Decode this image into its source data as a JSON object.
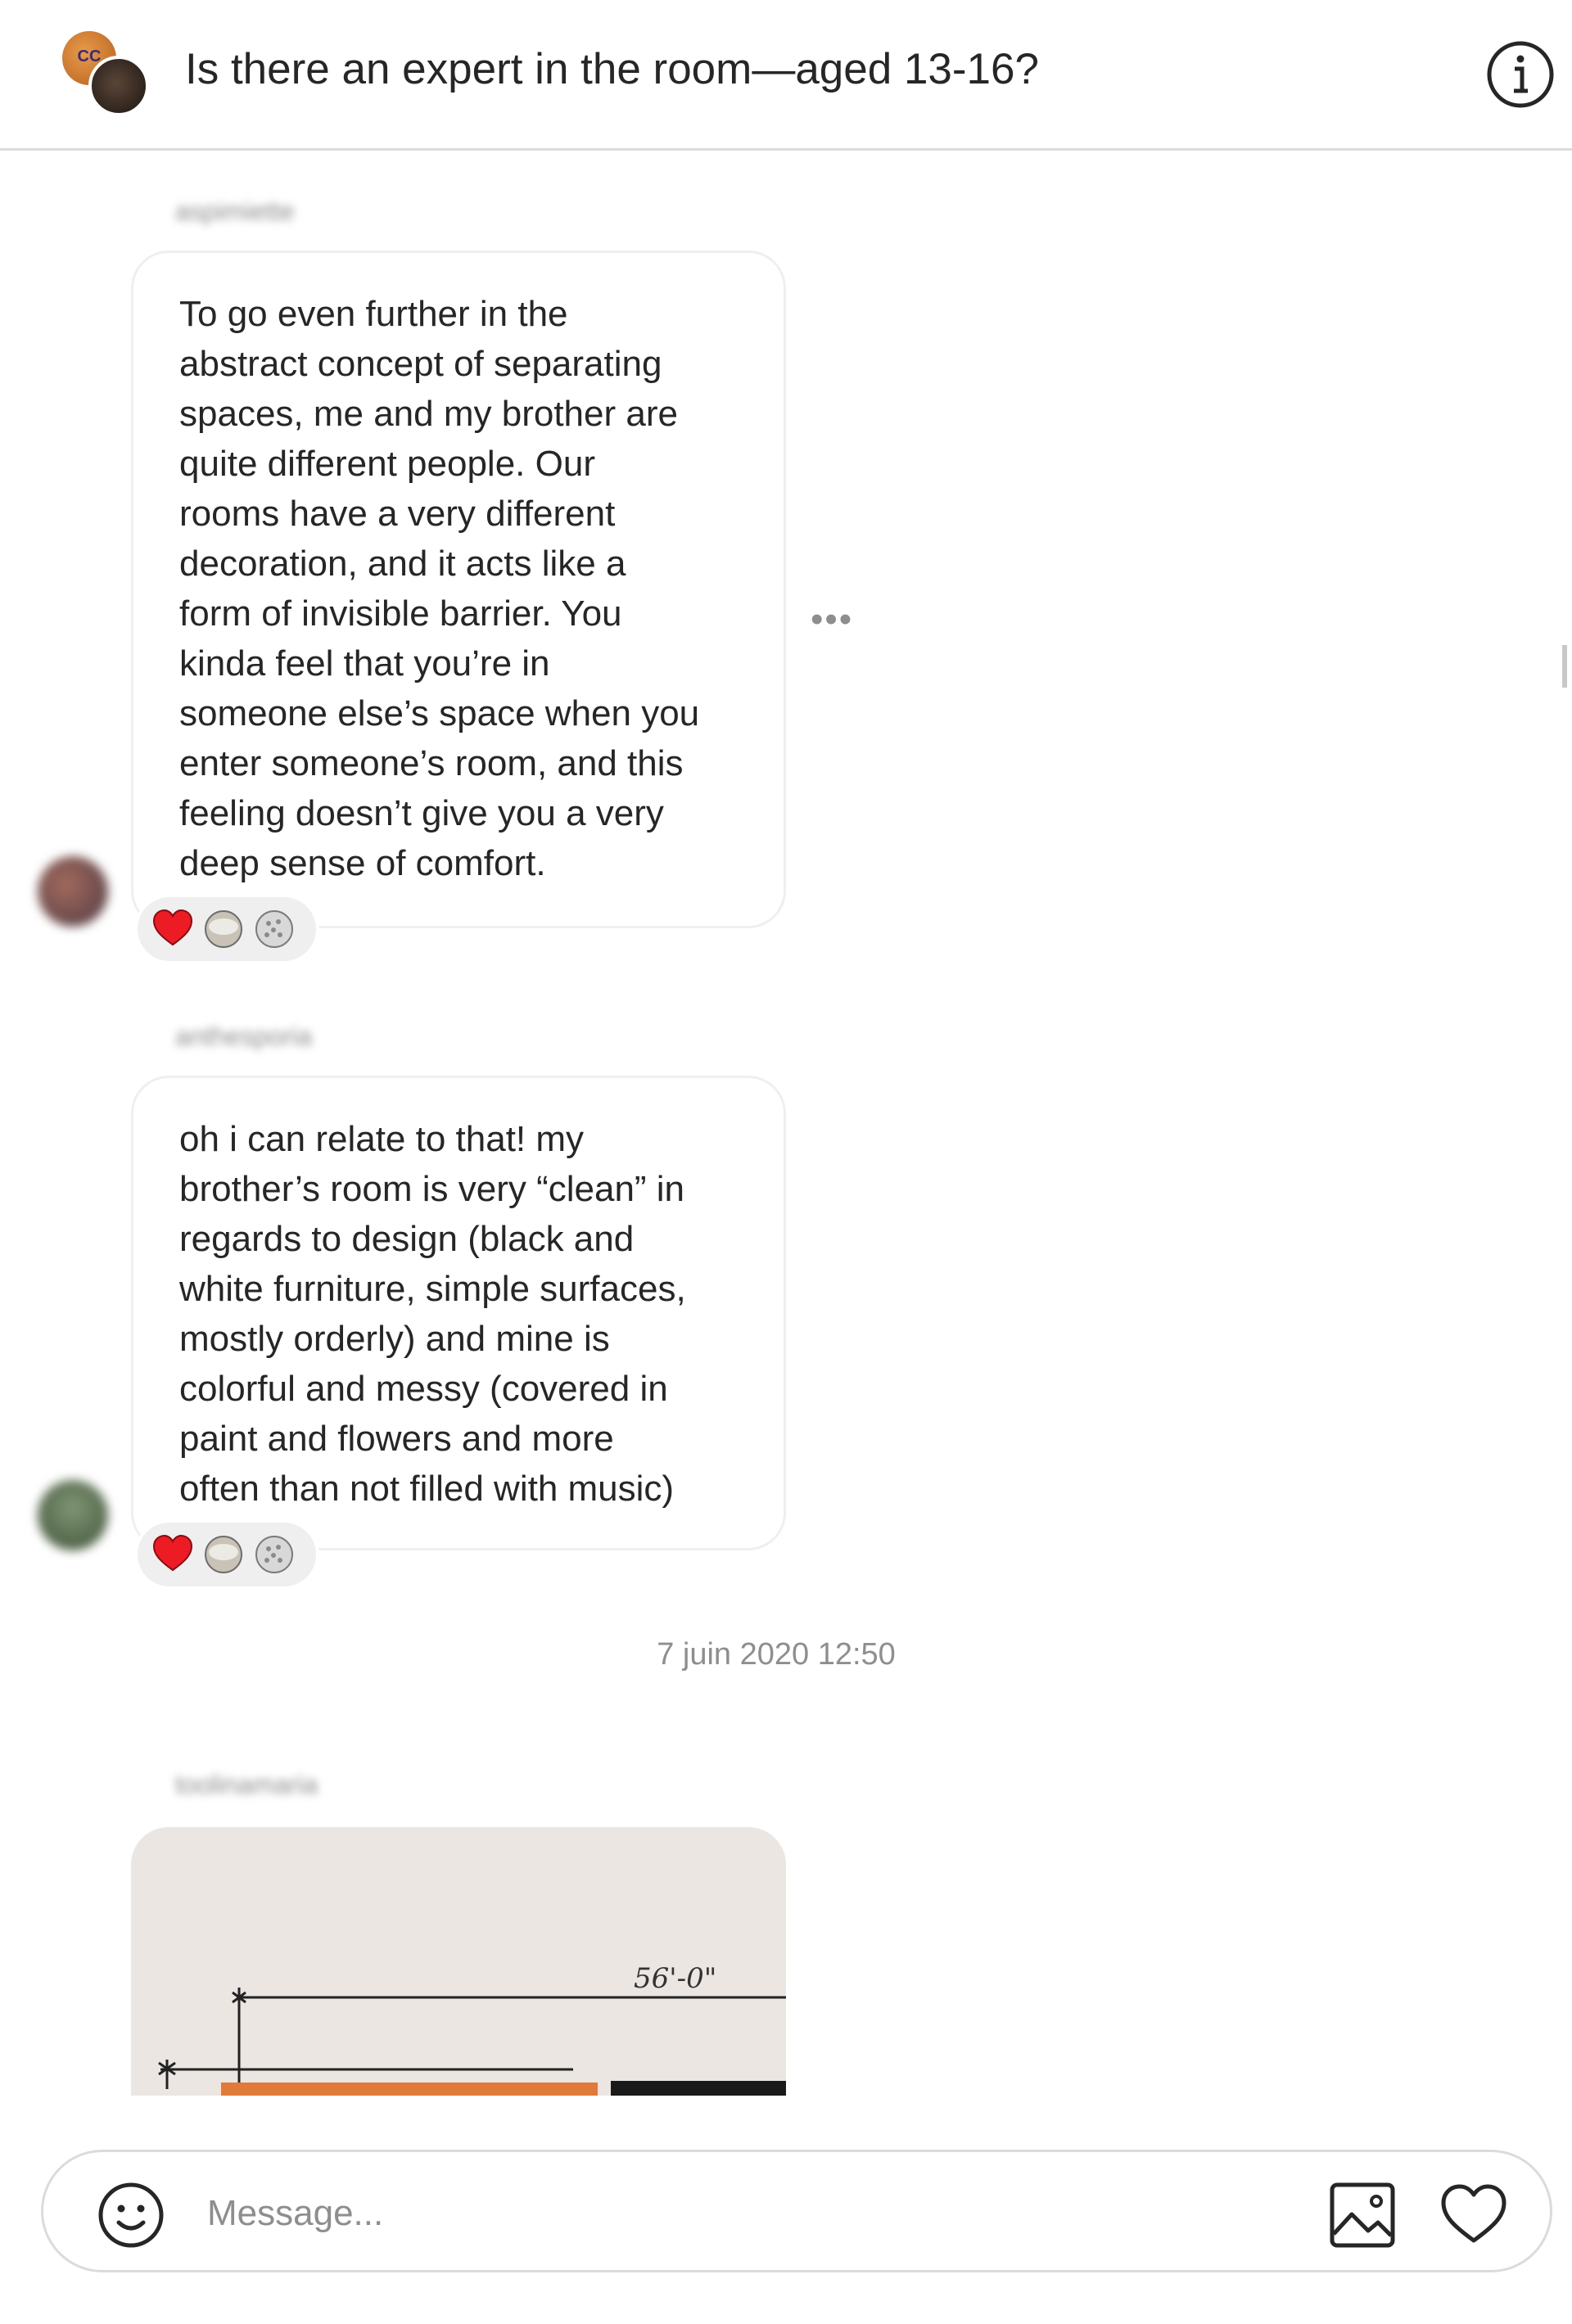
{
  "header": {
    "title": "Is there an expert in the room—aged 13-16?",
    "group_avatar_text": "CC",
    "info_icon": "info-icon"
  },
  "messages": [
    {
      "username": "aspimiette",
      "text": "To go even further in the\nabstract concept of separating\nspaces, me and my brother are\nquite different people. Our\nrooms have a very different\ndecoration, and it acts like a\nform of invisible barrier. You\nkinda feel that you’re in\nsomeone else’s space when you\nenter someone’s room, and this\nfeeling doesn’t give you a very\ndeep sense of comfort.",
      "reactions": [
        "heart-emoji",
        "reaction-emoji-2",
        "reaction-emoji-3"
      ],
      "more_label": "•••"
    },
    {
      "username": "anthesporia",
      "text": "oh i can relate to that! my\nbrother’s room is very “clean” in\nregards to design (black and\nwhite furniture, simple surfaces,\nmostly orderly) and mine is\ncolorful and messy (covered in\npaint and flowers and more\noften than not filled with music)",
      "reactions": [
        "heart-emoji",
        "reaction-emoji-2",
        "reaction-emoji-3"
      ]
    }
  ],
  "timestamp": "7 juin 2020 12:50",
  "image_message": {
    "username": "toolinamaria",
    "dimension_label": "56'-0\""
  },
  "composer": {
    "placeholder": "Message...",
    "value": ""
  },
  "colors": {
    "text": "#262626",
    "secondary": "#8e8e8e",
    "border": "#dbdbdb",
    "bubble_border": "#efefef",
    "heart": "#ed1c24"
  }
}
